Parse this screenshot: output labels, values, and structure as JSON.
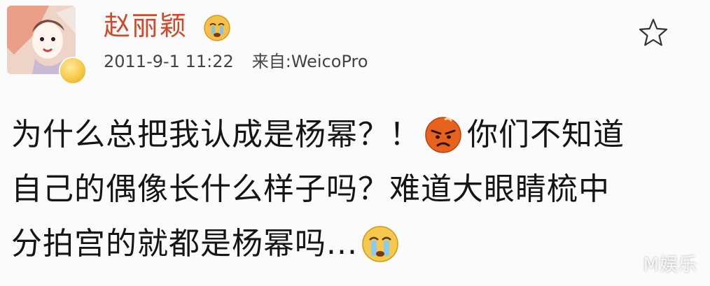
{
  "post": {
    "author": {
      "name": "赵丽颖",
      "avatar_icon": "avatar-cartoon-girl",
      "verified_icon": "vip-badge-icon",
      "name_emoji_icon": "crying-face-icon"
    },
    "timestamp": "2011-9-1 11:22",
    "source_prefix": "来自:",
    "source_app": "WeicoPro",
    "favorite_icon": "star-outline-icon",
    "content": {
      "line1_a": "为什么总把我认成是杨幂？！",
      "line1_emoji_icon": "angry-face-icon",
      "line1_b": "你们不知道",
      "line2": "自己的偶像长什么样子吗？难道大眼睛梳中",
      "line3": "分拍宫的就都是杨幂吗...",
      "line3_emoji_icon": "crying-face-icon"
    }
  },
  "watermark": "M娱乐",
  "colors": {
    "background": "#fbfbfb",
    "username": "#cf4a2a",
    "text": "#151515",
    "meta": "#444444"
  }
}
